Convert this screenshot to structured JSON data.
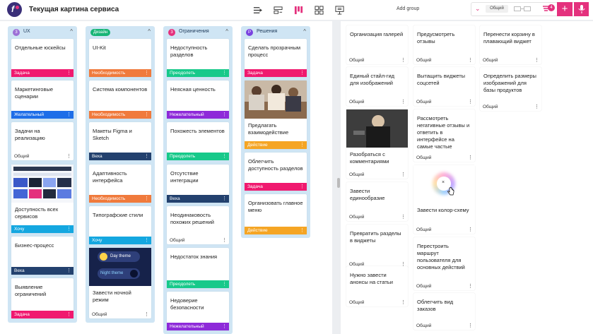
{
  "header": {
    "title": "Текущая картина сервиса",
    "add_group": "Add group",
    "mode_label": "Общий",
    "notif_count": "4",
    "view_icons": [
      "swimlane-view-icon",
      "card-list-view-icon",
      "kanban-view-icon",
      "grid-view-icon",
      "presentation-view-icon"
    ]
  },
  "colors": {
    "accent": "#e4317d",
    "zadacha": "#f0196f",
    "neobhodimost": "#f07a3c",
    "zhelatelny": "#1e6ee8",
    "veha": "#23416e",
    "hochu": "#14a7e0",
    "preodolet": "#17c98a",
    "nezhelatelny": "#8e2ad9",
    "deystvie": "#f5a524"
  },
  "columns": [
    {
      "badge": "3",
      "title": "UX",
      "badge_color": "#9c6fd6",
      "cards": [
        {
          "title": "Отдельные юскейсы",
          "tag": "Задача"
        },
        {
          "title": "Маркетинговые сценарии",
          "tag": "Желательный"
        },
        {
          "title": "Задачи на реализацию",
          "tag": "Общий"
        },
        {
          "title": "Доступность всех сервисов",
          "tag": "Хочу"
        },
        {
          "title": "Бизнес-процесс",
          "tag": "Веха"
        },
        {
          "title": "Выявление ограничений",
          "tag": "Задача"
        }
      ]
    },
    {
      "badge": "Дизайн",
      "title": "",
      "badge_color": "#17b576",
      "cards": [
        {
          "title": "UI-Kit",
          "tag": "Необходимость"
        },
        {
          "title": "Система компонентов",
          "tag": "Необходимость"
        },
        {
          "title": "Макеты Figma и Sketch",
          "tag": "Веха"
        },
        {
          "title": "Адаптивность интерфейса",
          "tag": "Необходимость"
        },
        {
          "title": "Типографские стили",
          "tag": "Хочу"
        },
        {
          "title": "Завести ночной режим",
          "tag": "Общий"
        }
      ],
      "day_theme": "Day theme",
      "night_theme": "Night theme"
    },
    {
      "badge": "3",
      "title": "Ограничения",
      "badge_color": "#e4317d",
      "cards": [
        {
          "title": "Недоступность разделов",
          "tag": "Преодолеть"
        },
        {
          "title": "Неясная ценность",
          "tag": "Нежелательный"
        },
        {
          "title": "Похожесть элементов",
          "tag": "Преодолеть"
        },
        {
          "title": "Отсутствие интеграции",
          "tag": "Веха"
        },
        {
          "title": "Неодинаковость похожих решений",
          "tag": "Общий"
        },
        {
          "title": "Недостаток знания",
          "tag": "Преодолеть"
        },
        {
          "title": "Недоверие безопасности",
          "tag": "Нежелательный"
        }
      ]
    },
    {
      "badge": "Р",
      "title": "Решения",
      "badge_color": "#7a42e0",
      "cards": [
        {
          "title": "Сделать прозрачным процесс",
          "tag": "Задача"
        },
        {
          "title": "Предлагать взаимодействие",
          "tag": "Действие"
        },
        {
          "title": "Облегчить доступность разделов",
          "tag": "Задача"
        },
        {
          "title": "Организовать главное меню",
          "tag": "Действие"
        }
      ]
    }
  ],
  "right_cards": [
    {
      "title": "Организация галерей",
      "tag": "Общий"
    },
    {
      "title": "Единый стайл-гид для изображений",
      "tag": "Общий"
    },
    {
      "title": "Разобраться с комментариями",
      "tag": "Общий"
    },
    {
      "title": "Завести единообразие",
      "tag": "Общий"
    },
    {
      "title": "Превратить разделы в виджеты",
      "tag": "Общий"
    },
    {
      "title": "Нужно завести анонсы на статьи",
      "tag": "Общий"
    },
    {
      "title": "Предусмотреть отзывы",
      "tag": "Общий"
    },
    {
      "title": "Вытащить виджеты соцсетей",
      "tag": "Общий"
    },
    {
      "title": "Рассмотреть негативные отзывы и ответить в интерфейсе на самые частые",
      "tag": "Общий"
    },
    {
      "title": "Завести колор-схему",
      "tag": "Общий"
    },
    {
      "title": "Перестроить маршрут пользователя для основных действий",
      "tag": "Общий"
    },
    {
      "title": "Облегчить вид заказов",
      "tag": "Общий"
    },
    {
      "title": "Перенести корзину в плавающий виджет",
      "tag": "Общий"
    },
    {
      "title": "Определить размеры изображений для базы продуктов",
      "tag": "Общий"
    }
  ],
  "menu_glyph": "⋮"
}
